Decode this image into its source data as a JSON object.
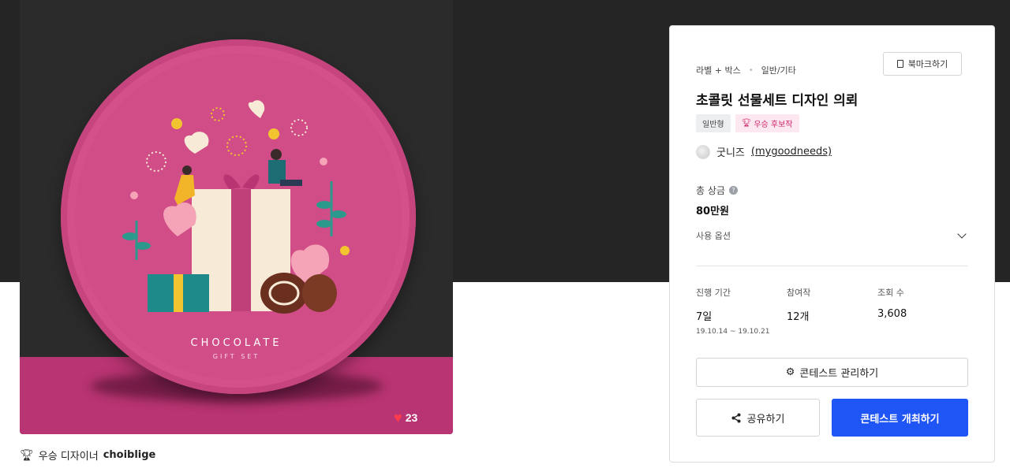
{
  "artwork": {
    "title_line1": "CHOCOLATE",
    "title_line2": "GIFT SET",
    "like_count": "23"
  },
  "winner": {
    "label": "우승 디자이너",
    "name": "choiblige"
  },
  "contest": {
    "category_primary": "라벨 + 박스",
    "category_secondary": "일반/기타",
    "bookmark_label": "북마크하기",
    "title": "초콜릿 선물세트 디자인 의뢰",
    "tags": [
      "일반형",
      "우승 후보작"
    ],
    "owner_name": "굿니즈",
    "owner_handle": "(mygoodneeds)",
    "prize_label": "총 상금",
    "prize_value": "80만원",
    "options_label": "사용 옵션",
    "stats": {
      "period_label": "진행 기간",
      "period_value": "7일",
      "period_range": "19.10.14 ~ 19.10.21",
      "entries_label": "참여작",
      "entries_value": "12개",
      "views_label": "조회 수",
      "views_value": "3,608"
    },
    "manage_button": "콘테스트 관리하기",
    "share_button": "공유하기",
    "host_button": "콘테스트 개최하기"
  },
  "colors": {
    "accent": "#2055f5",
    "plate_pink": "#d14d87",
    "floor_pink": "#b83472",
    "badge_pink": "#d0246a",
    "dark_band": "#252526"
  }
}
